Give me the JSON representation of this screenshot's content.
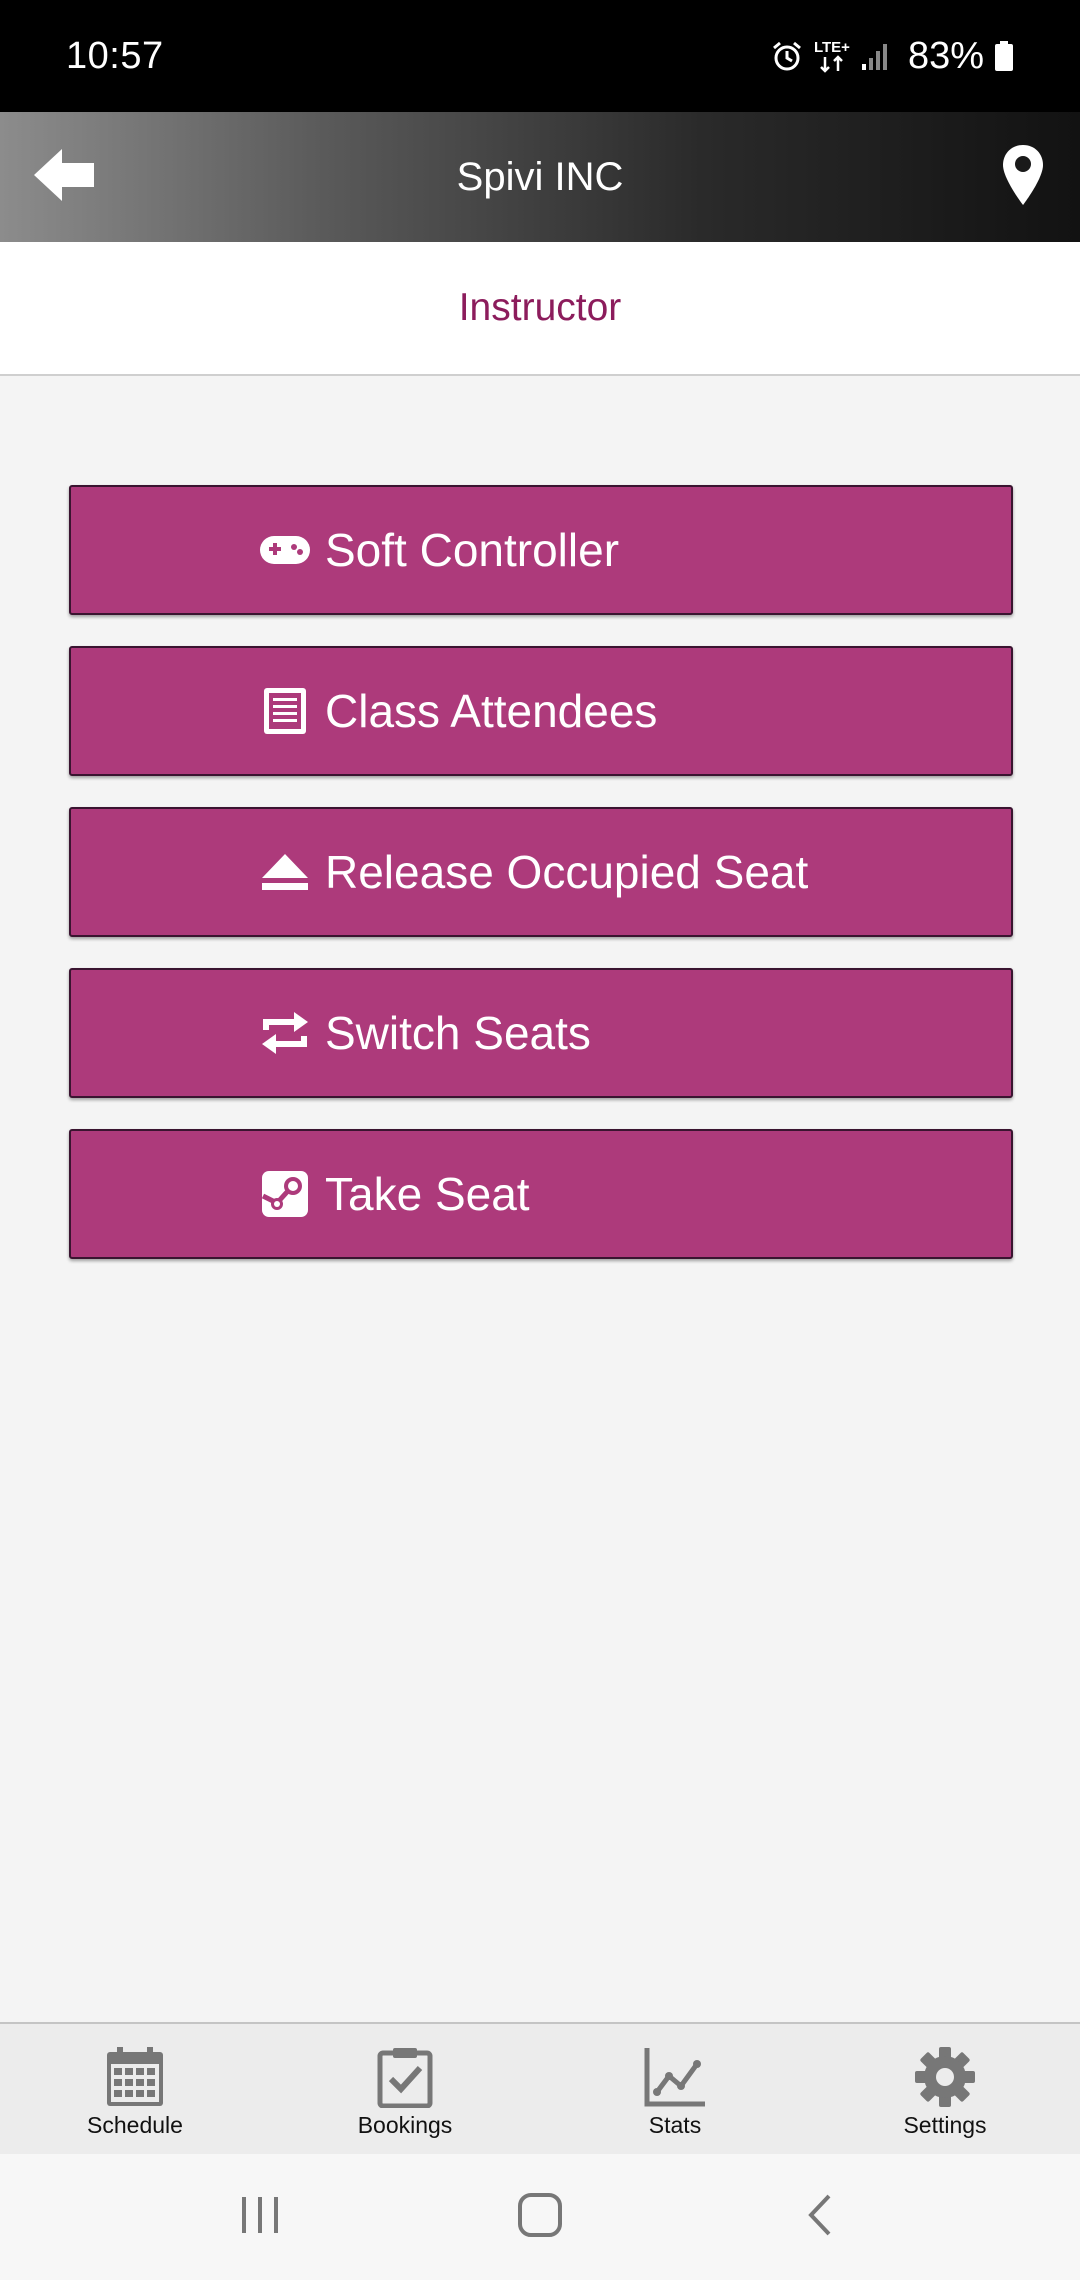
{
  "status_bar": {
    "time": "10:57",
    "network": "LTE+",
    "battery": "83%"
  },
  "header": {
    "title": "Spivi INC",
    "back_icon": "arrow-left-icon",
    "location_icon": "map-pin-icon"
  },
  "sub_header": {
    "title": "Instructor"
  },
  "menu": {
    "buttons": [
      {
        "label": "Soft Controller",
        "icon": "gamepad-icon"
      },
      {
        "label": "Class Attendees",
        "icon": "list-document-icon"
      },
      {
        "label": "Release Occupied Seat",
        "icon": "eject-icon"
      },
      {
        "label": "Switch Seats",
        "icon": "swap-arrows-icon"
      },
      {
        "label": "Take Seat",
        "icon": "steam-icon"
      }
    ]
  },
  "tabs": [
    {
      "label": "Schedule",
      "icon": "calendar-icon"
    },
    {
      "label": "Bookings",
      "icon": "clipboard-check-icon"
    },
    {
      "label": "Stats",
      "icon": "line-chart-icon"
    },
    {
      "label": "Settings",
      "icon": "gear-icon"
    }
  ],
  "colors": {
    "button": "#ad3a7b",
    "accent_text": "#8c1c5c",
    "background": "#f4f4f4"
  }
}
